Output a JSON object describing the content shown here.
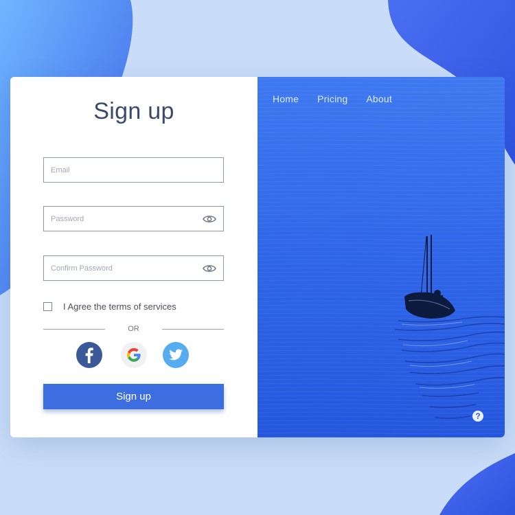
{
  "colors": {
    "accent": "#3d6ee0",
    "background": "#c7dcf7",
    "blob": "#3f66e6",
    "water": "#2f66e8",
    "title": "#3b4a6b"
  },
  "form": {
    "title": "Sign up",
    "email_placeholder": "Email",
    "password_placeholder": "Password",
    "confirm_placeholder": "Confirm Password",
    "agree_label": "I Agree the terms of services",
    "or_label": "OR",
    "submit_label": "Sign up"
  },
  "social": {
    "icons": [
      "facebook-icon",
      "google-icon",
      "twitter-icon"
    ]
  },
  "nav": {
    "home": "Home",
    "pricing": "Pricing",
    "about": "About"
  },
  "help": {
    "glyph": "?"
  }
}
